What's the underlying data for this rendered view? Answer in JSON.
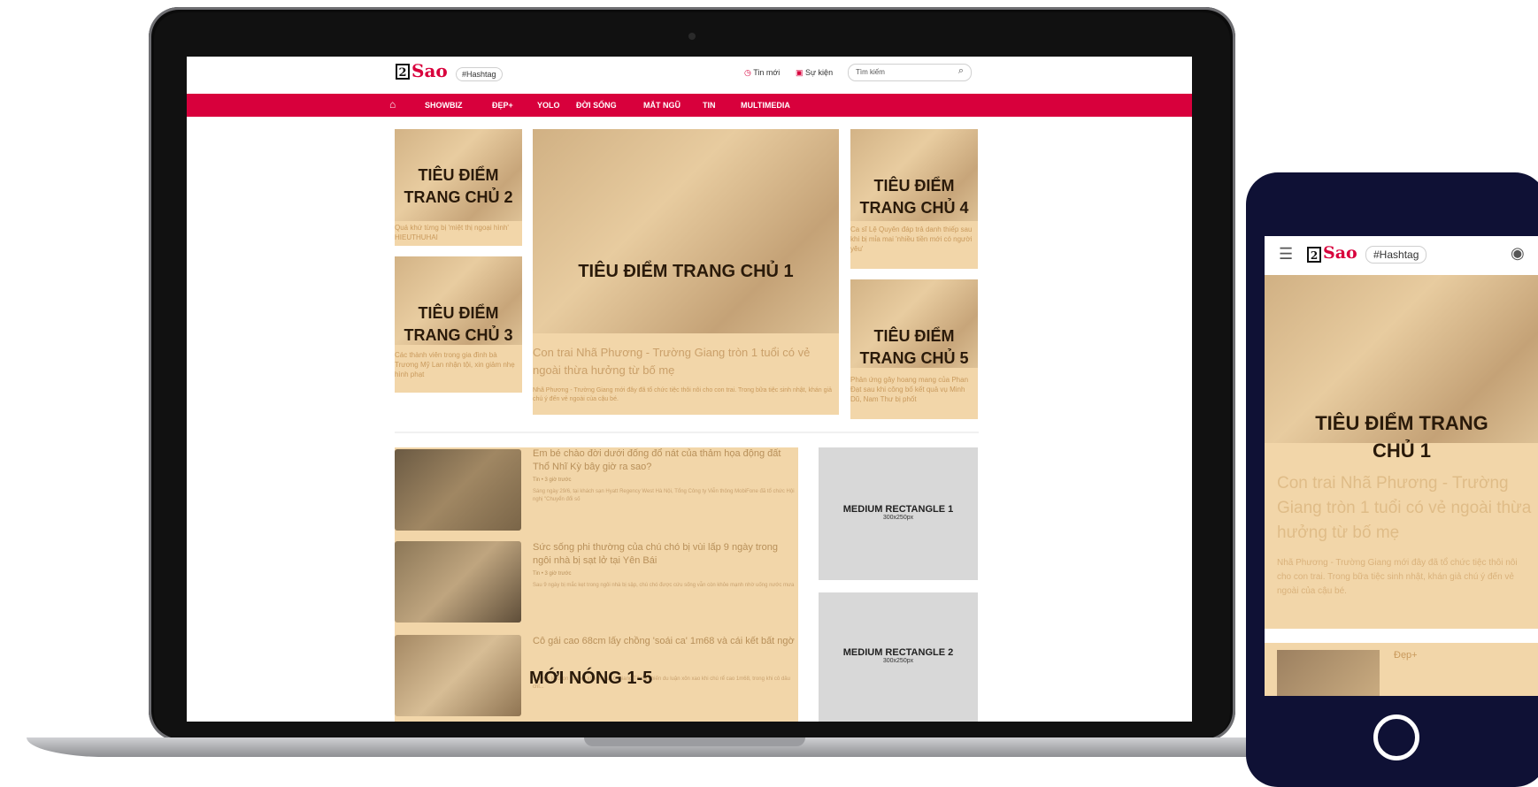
{
  "site": {
    "logo_number": "2",
    "logo_text": "Sao",
    "hashtag": "#Hashtag",
    "tin_moi": "Tin mới",
    "su_kien": "Sự kiện",
    "search_placeholder": "Tìm kiếm"
  },
  "nav": {
    "items": [
      "SHOWBIZ",
      "ĐẸP+",
      "YOLO",
      "ĐỜI SỐNG",
      "MẮT NGŨ",
      "TIN",
      "MULTIMEDIA"
    ]
  },
  "featured": {
    "main_label": "TIÊU ĐIỂM TRANG CHỦ 1",
    "main_title": "Con trai Nhã Phương - Trường Giang tròn 1 tuổi có vẻ ngoài thừa hưởng từ bố mẹ",
    "main_desc": "Nhã Phương - Trường Giang mới đây đã tổ chức tiệc thôi nôi cho con trai. Trong bữa tiệc sinh nhật, khán giả chú ý đến vẻ ngoài của cậu bé.",
    "tile2_label": "TIÊU ĐIỂM TRANG CHỦ 2",
    "tile2_text": "Quá khứ từng bị 'miệt thị ngoại hình' HIEUTHUHAI",
    "tile3_label": "TIÊU ĐIỂM TRANG CHỦ 3",
    "tile3_text": "Các thành viên trong gia đình bà Trương Mỹ Lan nhận tội, xin giảm nhẹ hình phạt",
    "tile4_label": "TIÊU ĐIỂM TRANG CHỦ 4",
    "tile4_text": "Ca sĩ Lệ Quyên đáp trả danh thiếp sau khi bị mỉa mai 'nhiều tiền mới có người yêu'",
    "tile5_label": "TIÊU ĐIỂM TRANG CHỦ 5",
    "tile5_text": "Phản ứng gây hoang mang của Phan Đạt sau khi công bố kết quả vụ Minh Dũ, Nam Thư bị phốt"
  },
  "hot": {
    "label": "MỚI NÓNG 1-5",
    "items": [
      {
        "title": "Em bé chào đời dưới đống đổ nát của thảm họa động đất Thổ Nhĩ Kỳ bây giờ ra sao?",
        "meta": "Tin • 3 giờ trước",
        "desc": "Sáng ngày 29/6, tại khách sạn Hyatt Regency West Hà Nội, Tổng Công ty Viễn thông MobiFone đã tổ chức Hội nghị \"Chuyển đổi số"
      },
      {
        "title": "Sức sống phi thường của chú chó bị vùi lấp 9 ngày trong ngôi nhà bị sạt lở tại Yên Bái",
        "meta": "Tin • 3 giờ trước",
        "desc": "Sau 9 ngày bị mắc kẹt trong ngôi nhà bị sập, chú chó được cứu sống vẫn còn khỏe mạnh nhờ uống nước mưa"
      },
      {
        "title": "Cô gái cao 68cm lấy chồng 'soái ca' 1m68 và cái kết bất ngờ",
        "meta": "",
        "desc": "...được lễ chọn tại một khách sạn ở Giang Tô đã khiến du luận xôn xao khi chú rể cao 1m68, trong khi cô dâu chỉ..."
      }
    ]
  },
  "ads": [
    {
      "title": "MEDIUM RECTANGLE 1",
      "size": "300x250px"
    },
    {
      "title": "MEDIUM RECTANGLE 2",
      "size": "300x250px"
    }
  ],
  "mobile": {
    "hashtag": "#Hashtag",
    "label": "TIÊU ĐIỂM TRANG CHỦ 1",
    "title": "Con trai Nhã Phương - Trường Giang tròn 1 tuổi có vẻ ngoài thừa hưởng từ bố mẹ",
    "desc": "Nhã Phương - Trường Giang mới đây đã tổ chức tiệc thôi nôi cho con trai. Trong bữa tiệc sinh nhật, khán giả chú ý đến vẻ ngoài của cậu bé.",
    "next_category": "Đẹp+"
  }
}
